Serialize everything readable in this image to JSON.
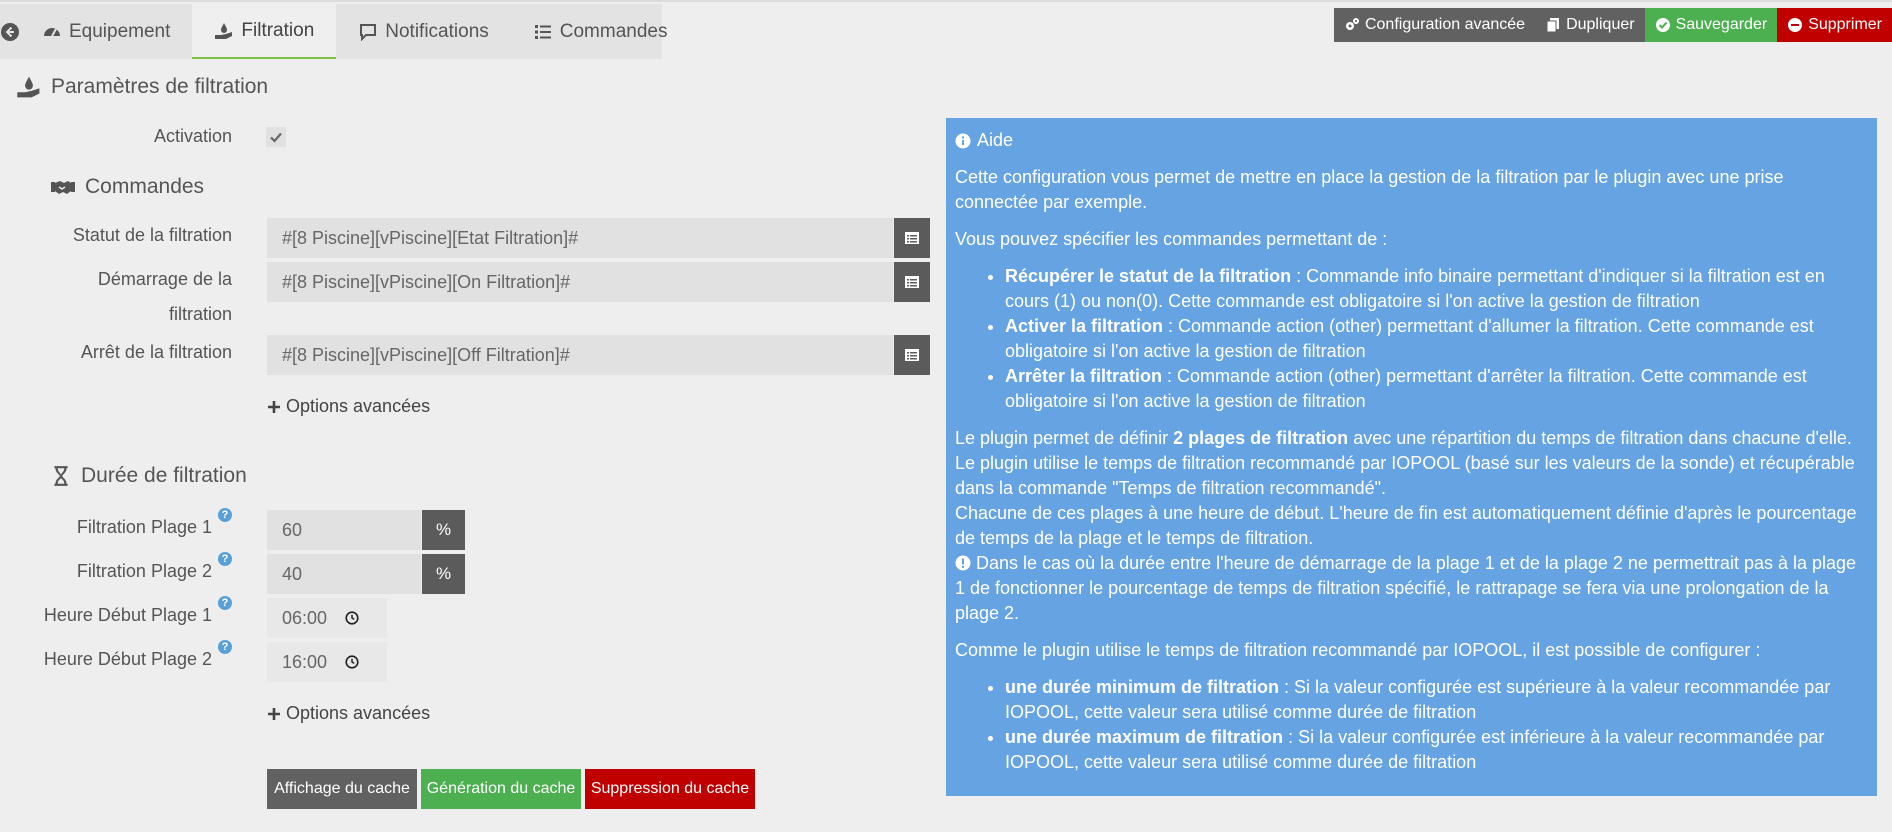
{
  "tabs": {
    "equipement": "Equipement",
    "filtration": "Filtration",
    "notifications": "Notifications",
    "commandes": "Commandes"
  },
  "actions": {
    "config": "Configuration avancée",
    "dupliquer": "Dupliquer",
    "sauvegarder": "Sauvegarder",
    "supprimer": "Supprimer"
  },
  "params": {
    "title": "Paramètres de filtration",
    "activation_label": "Activation",
    "activation_checked": true
  },
  "commandes": {
    "title": "Commandes",
    "statut_label": "Statut de la filtration",
    "statut_value": "#[8 Piscine][vPiscine][Etat Filtration]#",
    "demarrage_label_1": "Démarrage de la",
    "demarrage_label_2": "filtration",
    "demarrage_value": "#[8 Piscine][vPiscine][On Filtration]#",
    "arret_label": "Arrêt de la filtration",
    "arret_value": "#[8 Piscine][vPiscine][Off Filtration]#",
    "options": "Options avancées"
  },
  "duree": {
    "title": "Durée de filtration",
    "plage1_label": "Filtration Plage 1",
    "plage1_value": "60",
    "plage2_label": "Filtration Plage 2",
    "plage2_value": "40",
    "unit": "%",
    "debut1_label": "Heure Début Plage 1",
    "debut1_value": "06:00",
    "debut2_label": "Heure Début Plage 2",
    "debut2_value": "16:00",
    "options": "Options avancées",
    "help_mark": "?"
  },
  "cache": {
    "affichage": "Affichage du cache",
    "generation": "Génération du cache",
    "suppression": "Suppression du cache"
  },
  "aide": {
    "title": "Aide",
    "p1": "Cette configuration vous permet de mettre en place la gestion de la filtration par le plugin avec une prise connectée par exemple.",
    "p2": "Vous pouvez spécifier les commandes permettant de :",
    "li1_b": "Récupérer le statut de la filtration",
    "li1_t": " : Commande info binaire permettant d'indiquer si la filtration est en cours (1) ou non(0). Cette commande est obligatoire si l'on active la gestion de filtration",
    "li2_b": "Activer la filtration",
    "li2_t": " : Commande action (other) permettant d'allumer la filtration. Cette commande est obligatoire si l'on active la gestion de filtration",
    "li3_b": "Arrêter la filtration",
    "li3_t": " : Commande action (other) permettant d'arrêter la filtration. Cette commande est obligatoire si l'on active la gestion de filtration",
    "p3_a": "Le plugin permet de définir ",
    "p3_b": "2 plages de filtration",
    "p3_c": " avec une répartition du temps de filtration dans chacune d'elle.",
    "p3_d": "Le plugin utilise le temps de filtration recommandé par IOPOOL (basé sur les valeurs de la sonde) et récupérable dans la commande \"Temps de filtration recommandé\".",
    "p3_e": "Chacune de ces plages à une heure de début. L'heure de fin est automatiquement définie d'après le pourcentage de temps de la plage et le temps de filtration.",
    "p3_f": "Dans le cas où la durée entre l'heure de démarrage de la plage 1 et de la plage 2 ne permettrait pas à la plage 1 de fonctionner le pourcentage de temps de filtration spécifié, le rattrapage se fera via une prolongation de la plage 2.",
    "p4": "Comme le plugin utilise le temps de filtration recommandé par IOPOOL, il est possible de configurer :",
    "li4_b": "une durée minimum de filtration",
    "li4_t": " : Si la valeur configurée est supérieure à la valeur recommandée par IOPOOL, cette valeur sera utilisé comme durée de filtration",
    "li5_b": "une durée maximum de filtration",
    "li5_t": " : Si la valeur configurée est inférieure à la valeur recommandée par IOPOOL, cette valeur sera utilisé comme durée de filtration"
  },
  "colors": {
    "accent_green": "#4caf50",
    "danger_red": "#c00000",
    "aide_blue": "#66a3e2",
    "dark_button": "#616161"
  }
}
